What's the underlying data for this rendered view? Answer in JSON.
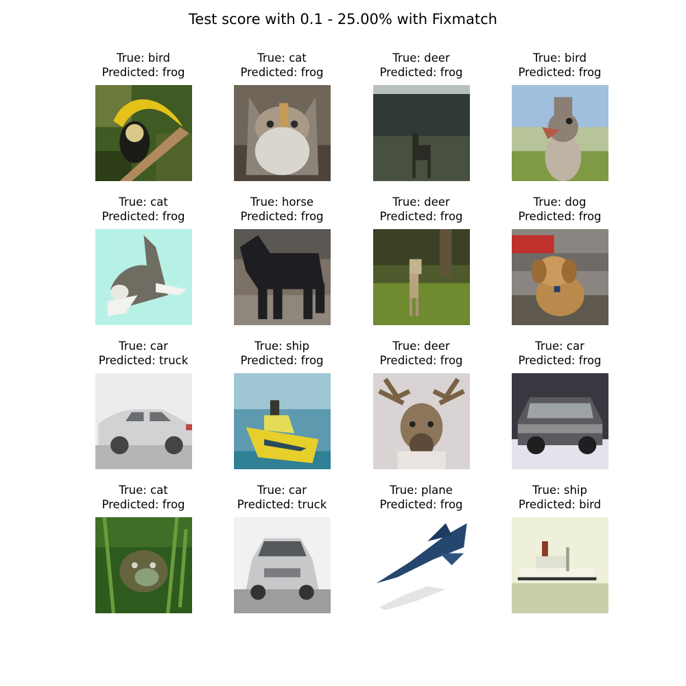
{
  "title": "Test score with 0.1 - 25.00% with Fixmatch",
  "grid": [
    {
      "true_label": "True: bird",
      "predicted_label": "Predicted: frog",
      "subject": "hornbill"
    },
    {
      "true_label": "True: cat",
      "predicted_label": "Predicted: frog",
      "subject": "fluffy-cat"
    },
    {
      "true_label": "True: deer",
      "predicted_label": "Predicted: frog",
      "subject": "deer-dark-field"
    },
    {
      "true_label": "True: bird",
      "predicted_label": "Predicted: frog",
      "subject": "ostrich"
    },
    {
      "true_label": "True: cat",
      "predicted_label": "Predicted: frog",
      "subject": "cat-jumping"
    },
    {
      "true_label": "True: horse",
      "predicted_label": "Predicted: frog",
      "subject": "black-horse"
    },
    {
      "true_label": "True: deer",
      "predicted_label": "Predicted: frog",
      "subject": "fawn-in-forest"
    },
    {
      "true_label": "True: dog",
      "predicted_label": "Predicted: frog",
      "subject": "puppy"
    },
    {
      "true_label": "True: car",
      "predicted_label": "Predicted: truck",
      "subject": "white-hatchback"
    },
    {
      "true_label": "True: ship",
      "predicted_label": "Predicted: frog",
      "subject": "yellow-boat"
    },
    {
      "true_label": "True: deer",
      "predicted_label": "Predicted: frog",
      "subject": "reindeer"
    },
    {
      "true_label": "True: car",
      "predicted_label": "Predicted: frog",
      "subject": "dark-suv"
    },
    {
      "true_label": "True: cat",
      "predicted_label": "Predicted: frog",
      "subject": "cat-in-grass"
    },
    {
      "true_label": "True: car",
      "predicted_label": "Predicted: truck",
      "subject": "silver-sedan"
    },
    {
      "true_label": "True: plane",
      "predicted_label": "Predicted: frog",
      "subject": "blue-jet"
    },
    {
      "true_label": "True: ship",
      "predicted_label": "Predicted: bird",
      "subject": "white-ship"
    }
  ]
}
